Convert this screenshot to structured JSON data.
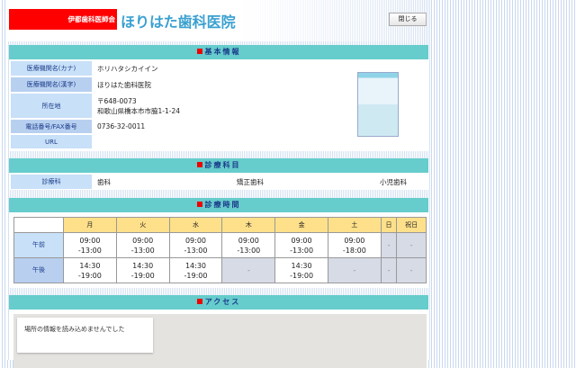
{
  "header": {
    "association": "伊都歯科医師会",
    "clinic_title": "ほりはた歯科医院",
    "close_label": "閉じる"
  },
  "basic": {
    "heading": "基本情報",
    "rows": [
      {
        "label": "医療機関名(カナ)",
        "value": "ホリハタシカイイン"
      },
      {
        "label": "医療機関名(漢字)",
        "value": "ほりはた歯科医院"
      },
      {
        "label": "所在地",
        "postal": "〒648-0073",
        "address": "和歌山県橋本市市脇1-1-24"
      },
      {
        "label": "電話番号/FAX番号",
        "value": "0736-32-0011"
      },
      {
        "label": "URL",
        "value": ""
      }
    ]
  },
  "departments": {
    "heading": "診療科目",
    "label": "診療科",
    "items": [
      "歯科",
      "矯正歯科",
      "小児歯科"
    ]
  },
  "hours": {
    "heading": "診療時間",
    "days": [
      "月",
      "火",
      "水",
      "木",
      "金",
      "土",
      "日",
      "祝日"
    ],
    "rows": [
      {
        "label": "午前",
        "cells": [
          [
            "09:00",
            "-13:00"
          ],
          [
            "09:00",
            "-13:00"
          ],
          [
            "09:00",
            "-13:00"
          ],
          [
            "09:00",
            "-13:00"
          ],
          [
            "09:00",
            "-13:00"
          ],
          [
            "09:00",
            "-18:00"
          ],
          [
            "-"
          ],
          [
            "-"
          ]
        ]
      },
      {
        "label": "午後",
        "cells": [
          [
            "14:30",
            "-19:00"
          ],
          [
            "14:30",
            "-19:00"
          ],
          [
            "14:30",
            "-19:00"
          ],
          [
            "-"
          ],
          [
            "14:30",
            "-19:00"
          ],
          [
            "-"
          ],
          [
            "-"
          ],
          [
            "-"
          ]
        ]
      }
    ]
  },
  "access": {
    "heading": "アクセス",
    "map_message": "場所の情報を読み込めませんでした"
  }
}
